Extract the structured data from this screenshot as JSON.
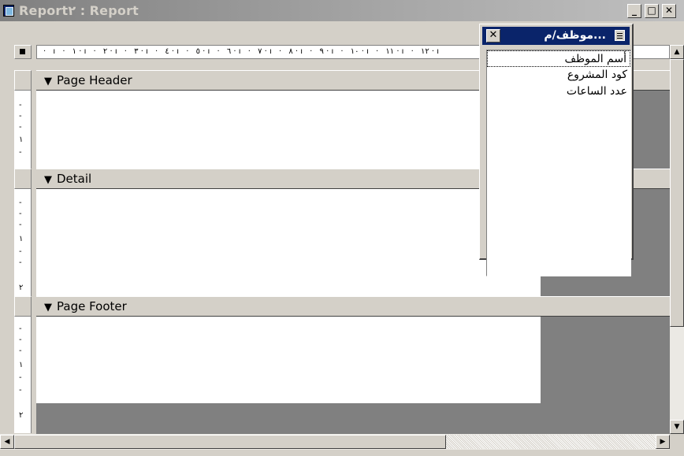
{
  "window": {
    "title": "Report٢ : Report",
    "minimize_label": "_",
    "maximize_label": "□",
    "close_label": "✕"
  },
  "ruler": {
    "horizontal_marks": "· ı · ١ · ı · ٢ · ı · ٣ · ı · ٤ · ı · ٥ · ı · ٦ · ı · ٧ · ı · ٨ · ı · ٩ · ı · ١٠ · ı · ١١ · ı · ١٢ · ı",
    "vertical_marks_header": [
      "-",
      "-",
      "-",
      "١",
      "-"
    ],
    "vertical_marks_detail": [
      "-",
      "-",
      "-",
      "١",
      "-",
      "-",
      "٢"
    ],
    "vertical_marks_footer": [
      "-",
      "-",
      "-",
      "١",
      "-",
      "-",
      "٢"
    ]
  },
  "sections": [
    {
      "label": "Page Header"
    },
    {
      "label": "Detail"
    },
    {
      "label": "Page Footer"
    }
  ],
  "field_list": {
    "title": "...موظف/م",
    "close_label": "✕",
    "items": [
      "أسم الموظف",
      "كود المشروع",
      "عدد الساعات"
    ],
    "selected_index": 0
  },
  "scrollbars": {
    "up_arrow": "▲",
    "down_arrow": "▼",
    "left_arrow": "◀",
    "right_arrow": "▶"
  },
  "icons": {
    "section_marker": "▼",
    "app_icon": "report-icon"
  }
}
